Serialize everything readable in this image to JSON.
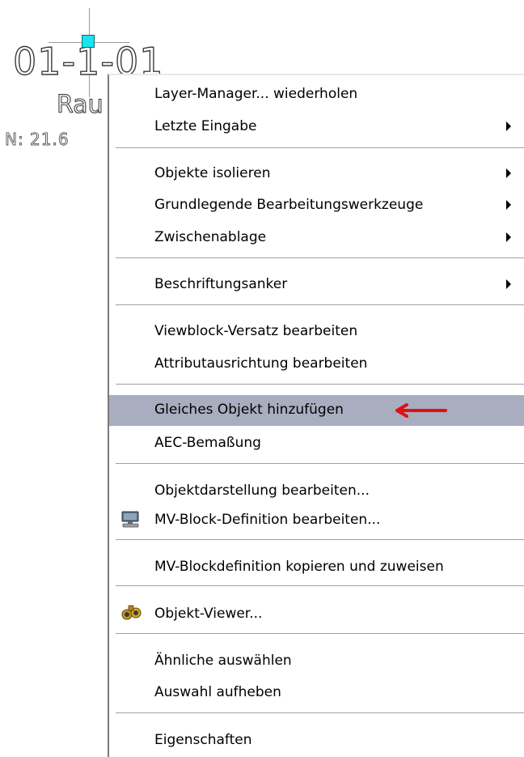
{
  "drawing": {
    "room_number": "01-1-01",
    "room_name": "Rau",
    "room_area": "N: 21.6"
  },
  "menu": {
    "items": [
      {
        "label": "Layer-Manager... wiederholen",
        "submenu": false
      },
      {
        "label": "Letzte Eingabe",
        "submenu": true
      },
      {
        "label": "Objekte isolieren",
        "submenu": true
      },
      {
        "label": "Grundlegende Bearbeitungswerkzeuge",
        "submenu": true
      },
      {
        "label": "Zwischenablage",
        "submenu": true
      },
      {
        "label": "Beschriftungsanker",
        "submenu": true
      },
      {
        "label": "Viewblock-Versatz bearbeiten",
        "submenu": false
      },
      {
        "label": "Attributausrichtung bearbeiten",
        "submenu": false
      },
      {
        "label": "Gleiches Objekt hinzufügen",
        "submenu": false,
        "highlighted": true
      },
      {
        "label": "AEC-Bemaßung",
        "submenu": false
      },
      {
        "label": "Objektdarstellung bearbeiten...",
        "submenu": false
      },
      {
        "label": "MV-Block-Definition bearbeiten...",
        "submenu": false,
        "icon": "monitor-icon"
      },
      {
        "label": "MV-Blockdefinition kopieren und zuweisen",
        "submenu": false
      },
      {
        "label": "Objekt-Viewer...",
        "submenu": false,
        "icon": "binoculars-icon"
      },
      {
        "label": "Ähnliche auswählen",
        "submenu": false
      },
      {
        "label": "Auswahl aufheben",
        "submenu": false
      },
      {
        "label": "Eigenschaften",
        "submenu": false
      }
    ]
  },
  "colors": {
    "highlight": "#a8aec0",
    "grip": "#19e3ee",
    "annotation_arrow": "#e01010"
  }
}
